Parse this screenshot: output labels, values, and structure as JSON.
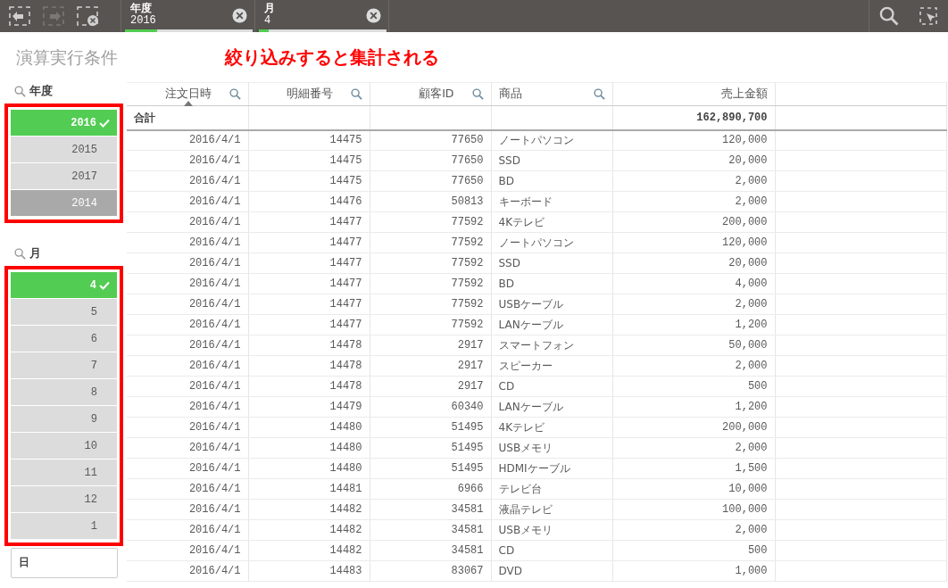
{
  "toolbar": {
    "back_disabled": false,
    "forward_disabled": true
  },
  "selections": [
    {
      "field": "年度",
      "value": "2016",
      "level": 0.25
    },
    {
      "field": "月",
      "value": "4",
      "level": 0.08
    }
  ],
  "sheet_title": "演算実行条件",
  "annotation": "絞り込みすると集計される",
  "filters": [
    {
      "title": "年度",
      "framed": true,
      "items": [
        {
          "label": "2016",
          "selected": true,
          "excluded": false
        },
        {
          "label": "2015",
          "selected": false,
          "excluded": false
        },
        {
          "label": "2017",
          "selected": false,
          "excluded": false
        },
        {
          "label": "2014",
          "selected": false,
          "excluded": true
        }
      ]
    },
    {
      "title": "月",
      "framed": true,
      "items": [
        {
          "label": "4",
          "selected": true,
          "excluded": false
        },
        {
          "label": "5",
          "selected": false,
          "excluded": false
        },
        {
          "label": "6",
          "selected": false,
          "excluded": false
        },
        {
          "label": "7",
          "selected": false,
          "excluded": false
        },
        {
          "label": "8",
          "selected": false,
          "excluded": false
        },
        {
          "label": "9",
          "selected": false,
          "excluded": false
        },
        {
          "label": "10",
          "selected": false,
          "excluded": false
        },
        {
          "label": "11",
          "selected": false,
          "excluded": false
        },
        {
          "label": "12",
          "selected": false,
          "excluded": false
        },
        {
          "label": "1",
          "selected": false,
          "excluded": false
        }
      ]
    }
  ],
  "collapsed_filter": {
    "title": "日"
  },
  "table": {
    "columns": [
      {
        "label": "注文日時",
        "searchable": true,
        "sorted": true
      },
      {
        "label": "明細番号",
        "searchable": true,
        "sorted": false
      },
      {
        "label": "顧客ID",
        "searchable": true,
        "sorted": false
      },
      {
        "label": "商品",
        "searchable": true,
        "sorted": false
      },
      {
        "label": "売上金額",
        "searchable": false,
        "sorted": false
      }
    ],
    "total": {
      "label": "合計",
      "value": "162,890,700"
    },
    "rows": [
      [
        "2016/4/1",
        "14475",
        "77650",
        "ノートパソコン",
        "120,000"
      ],
      [
        "2016/4/1",
        "14475",
        "77650",
        "SSD",
        "20,000"
      ],
      [
        "2016/4/1",
        "14475",
        "77650",
        "BD",
        "2,000"
      ],
      [
        "2016/4/1",
        "14476",
        "50813",
        "キーボード",
        "2,000"
      ],
      [
        "2016/4/1",
        "14477",
        "77592",
        "4Kテレビ",
        "200,000"
      ],
      [
        "2016/4/1",
        "14477",
        "77592",
        "ノートパソコン",
        "120,000"
      ],
      [
        "2016/4/1",
        "14477",
        "77592",
        "SSD",
        "20,000"
      ],
      [
        "2016/4/1",
        "14477",
        "77592",
        "BD",
        "4,000"
      ],
      [
        "2016/4/1",
        "14477",
        "77592",
        "USBケーブル",
        "2,000"
      ],
      [
        "2016/4/1",
        "14477",
        "77592",
        "LANケーブル",
        "1,200"
      ],
      [
        "2016/4/1",
        "14478",
        "2917",
        "スマートフォン",
        "50,000"
      ],
      [
        "2016/4/1",
        "14478",
        "2917",
        "スピーカー",
        "2,000"
      ],
      [
        "2016/4/1",
        "14478",
        "2917",
        "CD",
        "500"
      ],
      [
        "2016/4/1",
        "14479",
        "60340",
        "LANケーブル",
        "1,200"
      ],
      [
        "2016/4/1",
        "14480",
        "51495",
        "4Kテレビ",
        "200,000"
      ],
      [
        "2016/4/1",
        "14480",
        "51495",
        "USBメモリ",
        "2,000"
      ],
      [
        "2016/4/1",
        "14480",
        "51495",
        "HDMIケーブル",
        "1,500"
      ],
      [
        "2016/4/1",
        "14481",
        "6966",
        "テレビ台",
        "10,000"
      ],
      [
        "2016/4/1",
        "14482",
        "34581",
        "液晶テレビ",
        "100,000"
      ],
      [
        "2016/4/1",
        "14482",
        "34581",
        "USBメモリ",
        "2,000"
      ],
      [
        "2016/4/1",
        "14482",
        "34581",
        "CD",
        "500"
      ],
      [
        "2016/4/1",
        "14483",
        "83067",
        "DVD",
        "1,000"
      ]
    ]
  }
}
